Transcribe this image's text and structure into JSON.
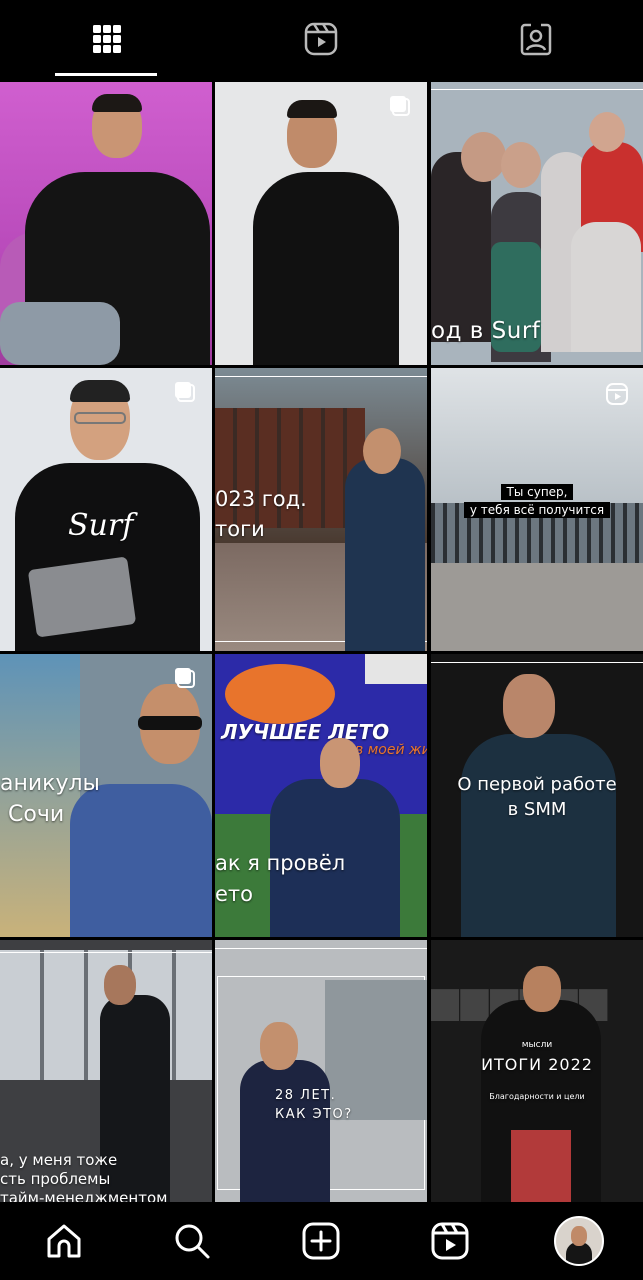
{
  "tabs": [
    {
      "name": "posts-grid",
      "icon": "grid-icon",
      "active": true
    },
    {
      "name": "reels",
      "icon": "reels-icon",
      "active": false
    },
    {
      "name": "tagged",
      "icon": "tagged-icon",
      "active": false
    }
  ],
  "posts": [
    {
      "caption": ""
    },
    {
      "caption": ""
    },
    {
      "caption": "од в Surf"
    },
    {
      "caption": "",
      "shirt_text": "Surf"
    },
    {
      "caption_line1": "023 год.",
      "caption_line2": "тоги"
    },
    {
      "caption_line1": "Ты супер,",
      "caption_line2": "у тебя всё получится"
    },
    {
      "caption_line1": "аникулы",
      "caption_line2": "Сочи"
    },
    {
      "banner": "ЛУЧШЕЕ ЛЕТО",
      "banner2": "в моей жи",
      "caption_line1": "ак я провёл",
      "caption_line2": "ето"
    },
    {
      "caption_line1": "О первой работе",
      "caption_line2": "в SMM"
    },
    {
      "caption_line1": "а, у меня тоже",
      "caption_line2": "сть проблемы",
      "caption_line3": "тайм-менеджментом"
    },
    {
      "caption_line1": "28 ЛЕТ.",
      "caption_line2": "КАК ЭТО?"
    },
    {
      "top_label": "мысли",
      "title": "ИТОГИ 2022",
      "subtitle": "Благодарности и цели"
    }
  ],
  "bottom_nav": [
    {
      "name": "home",
      "icon": "home-icon"
    },
    {
      "name": "search",
      "icon": "search-icon"
    },
    {
      "name": "create",
      "icon": "add-post-icon"
    },
    {
      "name": "reels",
      "icon": "reels-icon"
    },
    {
      "name": "profile",
      "icon": "profile-avatar"
    }
  ],
  "colors": {
    "background": "#000000",
    "icon": "#ffffff",
    "pink_bg": "#c64bc2",
    "banner_blue": "#2c2aa8",
    "banner_orange": "#e8742c"
  }
}
